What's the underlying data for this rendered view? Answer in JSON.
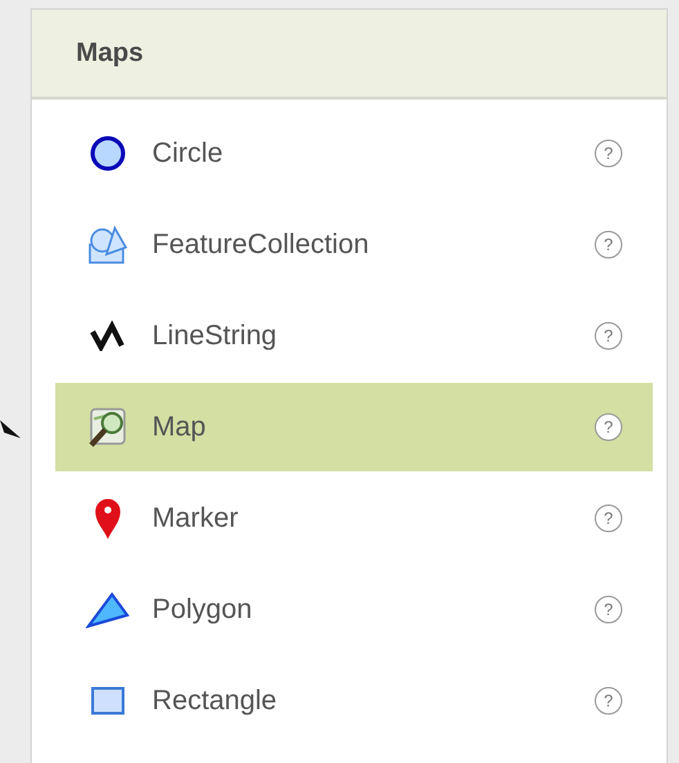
{
  "panel": {
    "title": "Maps"
  },
  "items": [
    {
      "label": "Circle",
      "kind": "circle",
      "selected": false,
      "help": "?"
    },
    {
      "label": "FeatureCollection",
      "kind": "collection",
      "selected": false,
      "help": "?"
    },
    {
      "label": "LineString",
      "kind": "linestring",
      "selected": false,
      "help": "?"
    },
    {
      "label": "Map",
      "kind": "map",
      "selected": true,
      "help": "?"
    },
    {
      "label": "Marker",
      "kind": "marker",
      "selected": false,
      "help": "?"
    },
    {
      "label": "Polygon",
      "kind": "polygon",
      "selected": false,
      "help": "?"
    },
    {
      "label": "Rectangle",
      "kind": "rectangle",
      "selected": false,
      "help": "?"
    }
  ]
}
